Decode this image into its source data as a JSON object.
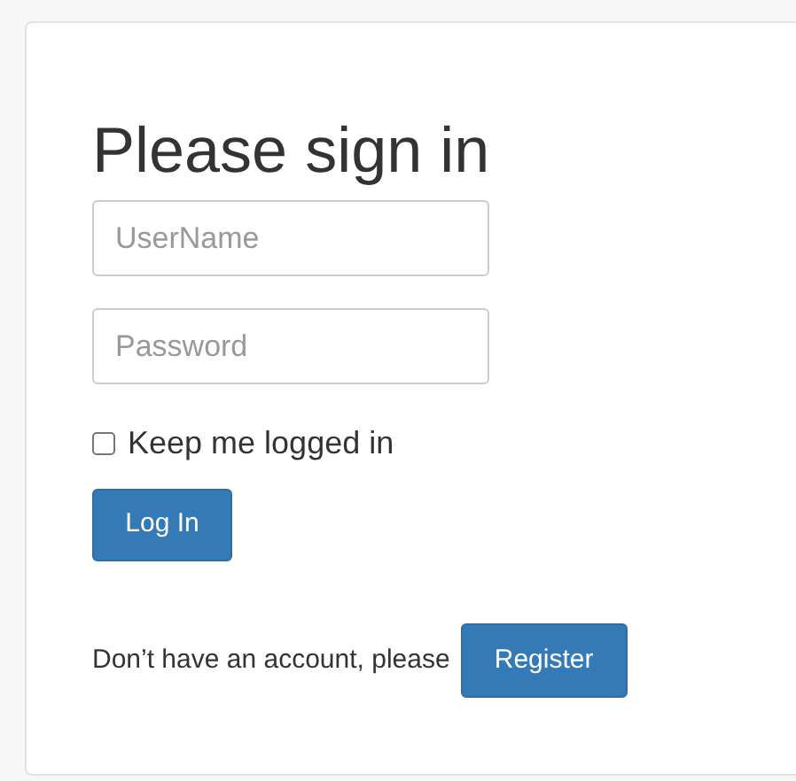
{
  "title": "Please sign in",
  "username": {
    "placeholder": "UserName"
  },
  "password": {
    "placeholder": "Password"
  },
  "remember": {
    "label": "Keep me logged in",
    "checked": false
  },
  "login_button": "Log In",
  "register_prompt": "Don’t have an account, please",
  "register_button": "Register"
}
